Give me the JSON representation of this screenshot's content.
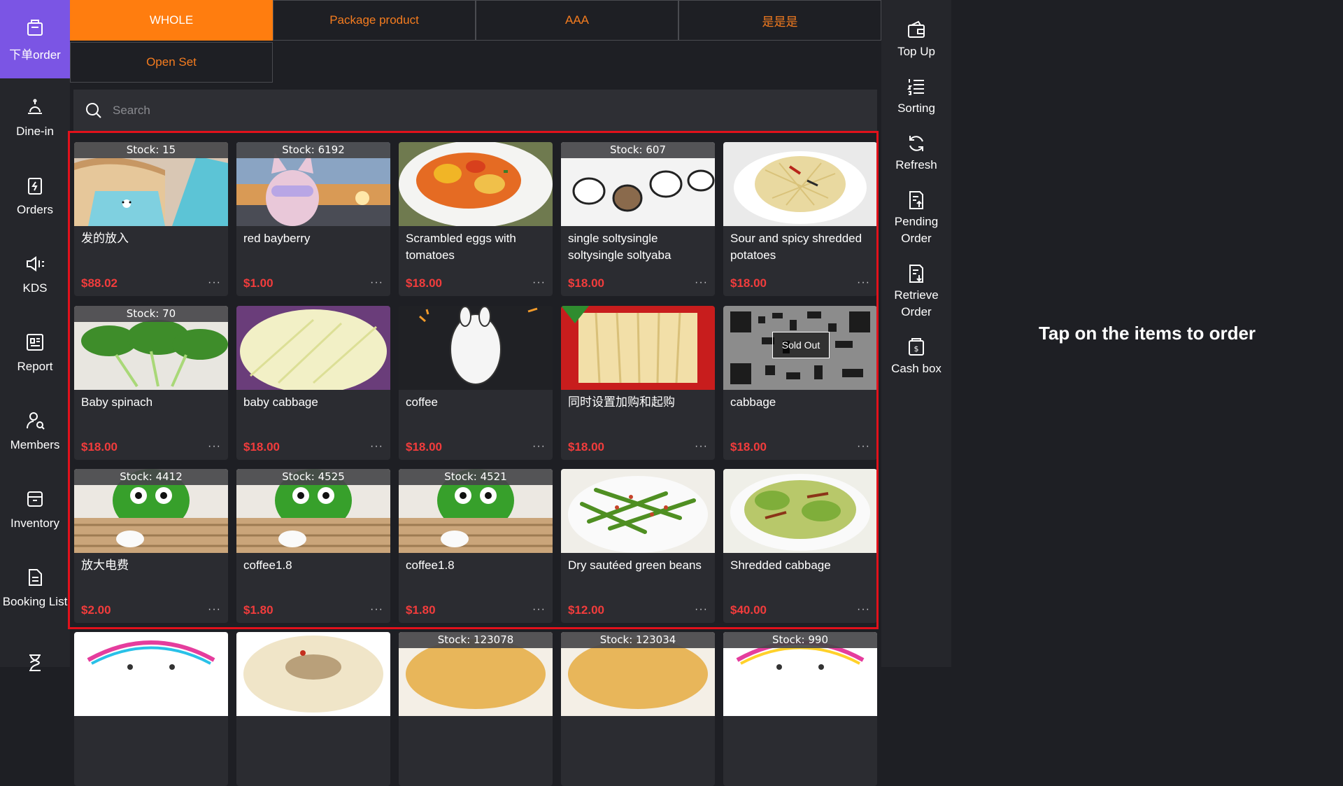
{
  "nav": {
    "items": [
      {
        "label": "下单order",
        "icon": "bag-icon"
      },
      {
        "label": "Dine-in",
        "icon": "bell-icon"
      },
      {
        "label": "Orders",
        "icon": "clipboard-icon"
      },
      {
        "label": "KDS",
        "icon": "speaker-icon"
      },
      {
        "label": "Report",
        "icon": "report-icon"
      },
      {
        "label": "Members",
        "icon": "members-icon"
      },
      {
        "label": "Inventory",
        "icon": "inventory-icon"
      },
      {
        "label": "Booking List",
        "icon": "booking-icon"
      },
      {
        "label": "",
        "icon": "hourglass-icon"
      }
    ]
  },
  "categories": [
    "WHOLE",
    "Package product",
    "AAA",
    "是是是",
    "Open Set"
  ],
  "active_category": "WHOLE",
  "search": {
    "placeholder": "Search"
  },
  "products": [
    {
      "name": "发的放入",
      "price": "$88.02",
      "stock": "Stock:  15"
    },
    {
      "name": "red bayberry",
      "price": "$1.00",
      "stock": "Stock:  6192"
    },
    {
      "name": "Scrambled eggs with tomatoes",
      "price": "$18.00",
      "stock": ""
    },
    {
      "name": "single soltysingle soltysingle soltyaba",
      "price": "$18.00",
      "stock": "Stock:  607"
    },
    {
      "name": "Sour and spicy shredded potatoes",
      "price": "$18.00",
      "stock": ""
    },
    {
      "name": "Baby spinach",
      "price": "$18.00",
      "stock": "Stock:  70"
    },
    {
      "name": "baby cabbage",
      "price": "$18.00",
      "stock": ""
    },
    {
      "name": "coffee",
      "price": "$18.00",
      "stock": ""
    },
    {
      "name": "同时设置加购和起购",
      "price": "$18.00",
      "stock": ""
    },
    {
      "name": "cabbage",
      "price": "$18.00",
      "stock": "",
      "sold_out": "Sold Out"
    },
    {
      "name": "放大电费",
      "price": "$2.00",
      "stock": "Stock:  4412"
    },
    {
      "name": "coffee1.8",
      "price": "$1.80",
      "stock": "Stock:  4525"
    },
    {
      "name": "coffee1.8",
      "price": "$1.80",
      "stock": "Stock:  4521"
    },
    {
      "name": "Dry sautéed green beans",
      "price": "$12.00",
      "stock": ""
    },
    {
      "name": "Shredded cabbage",
      "price": "$40.00",
      "stock": ""
    },
    {
      "name": "",
      "price": "",
      "stock": ""
    },
    {
      "name": "",
      "price": "",
      "stock": ""
    },
    {
      "name": "",
      "price": "",
      "stock": "Stock:  123078"
    },
    {
      "name": "",
      "price": "",
      "stock": "Stock:  123034"
    },
    {
      "name": "",
      "price": "",
      "stock": "Stock:  990"
    }
  ],
  "more_glyph": "···",
  "actions": [
    {
      "label": "Top Up",
      "icon": "wallet-icon"
    },
    {
      "label": "Sorting",
      "icon": "sorting-icon"
    },
    {
      "label": "Refresh",
      "icon": "refresh-icon"
    },
    {
      "label": "Pending Order",
      "icon": "pending-order-icon"
    },
    {
      "label": "Retrieve Order",
      "icon": "retrieve-order-icon"
    },
    {
      "label": "Cash box",
      "icon": "cash-box-icon"
    }
  ],
  "empty_hint": "Tap on the items to order",
  "colors": {
    "accent_orange": "#ff7d0f",
    "nav_active": "#7b55e4",
    "price_red": "#f23c3c",
    "highlight": "#e1111b"
  }
}
